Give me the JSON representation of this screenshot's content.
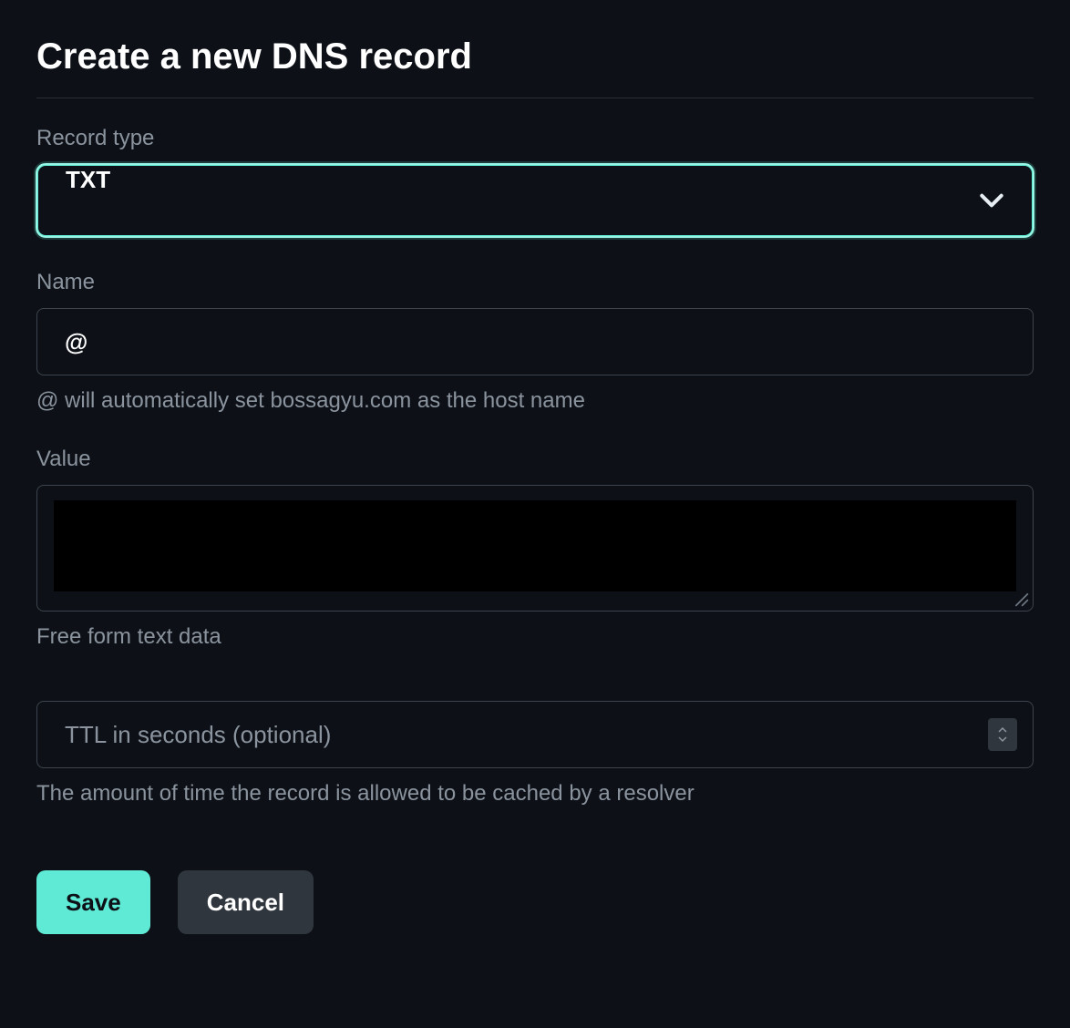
{
  "header": {
    "title": "Create a new DNS record"
  },
  "recordType": {
    "label": "Record type",
    "value": "TXT"
  },
  "name": {
    "label": "Name",
    "value": "@",
    "hint": "@ will automatically set bossagyu.com as the host name"
  },
  "value": {
    "label": "Value",
    "text": "",
    "hint": "Free form text data"
  },
  "ttl": {
    "placeholder": "TTL in seconds (optional)",
    "value": "",
    "hint": "The amount of time the record is allowed to be cached by a resolver"
  },
  "buttons": {
    "save": "Save",
    "cancel": "Cancel"
  }
}
